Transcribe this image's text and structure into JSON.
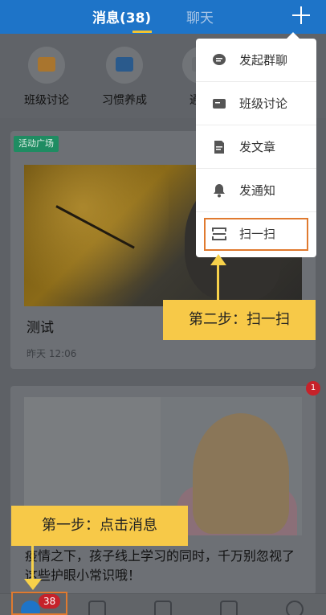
{
  "header": {
    "tab_messages": "消息(38)",
    "tab_chat": "聊天",
    "plus_icon": "plus-icon"
  },
  "shortcuts": [
    {
      "label": "班级讨论",
      "icon": "class-discussion-icon"
    },
    {
      "label": "习惯养成",
      "icon": "calendar-check-icon"
    },
    {
      "label": "通知",
      "icon": "notice-icon"
    }
  ],
  "popup_menu": {
    "items": [
      {
        "label": "发起群聊",
        "icon": "chat-bubble-icon"
      },
      {
        "label": "班级讨论",
        "icon": "class-discussion-icon"
      },
      {
        "label": "发文章",
        "icon": "document-icon"
      },
      {
        "label": "发通知",
        "icon": "bell-icon"
      },
      {
        "label": "扫一扫",
        "icon": "scan-icon"
      }
    ]
  },
  "feed": {
    "card1": {
      "tag": "活动广场",
      "title": "测试",
      "time": "昨天 12:06"
    },
    "card2": {
      "badge": "1",
      "title": "疫情之下，孩子线上学习的同时，千万别忽视了这些护眼小常识哦！"
    }
  },
  "callouts": {
    "step1": "第一步：点击消息",
    "step2": "第二步：扫一扫"
  },
  "bottom_nav": {
    "messages_count": "38",
    "items": [
      "messages-icon",
      "home-icon",
      "apps-icon",
      "contacts-icon",
      "profile-icon"
    ]
  },
  "colors": {
    "header_blue": "#1e74c8",
    "callout_yellow": "#f7c948",
    "highlight_orange": "#e07a2f",
    "badge_red": "#c6222a",
    "tag_green": "#1f8c62"
  }
}
